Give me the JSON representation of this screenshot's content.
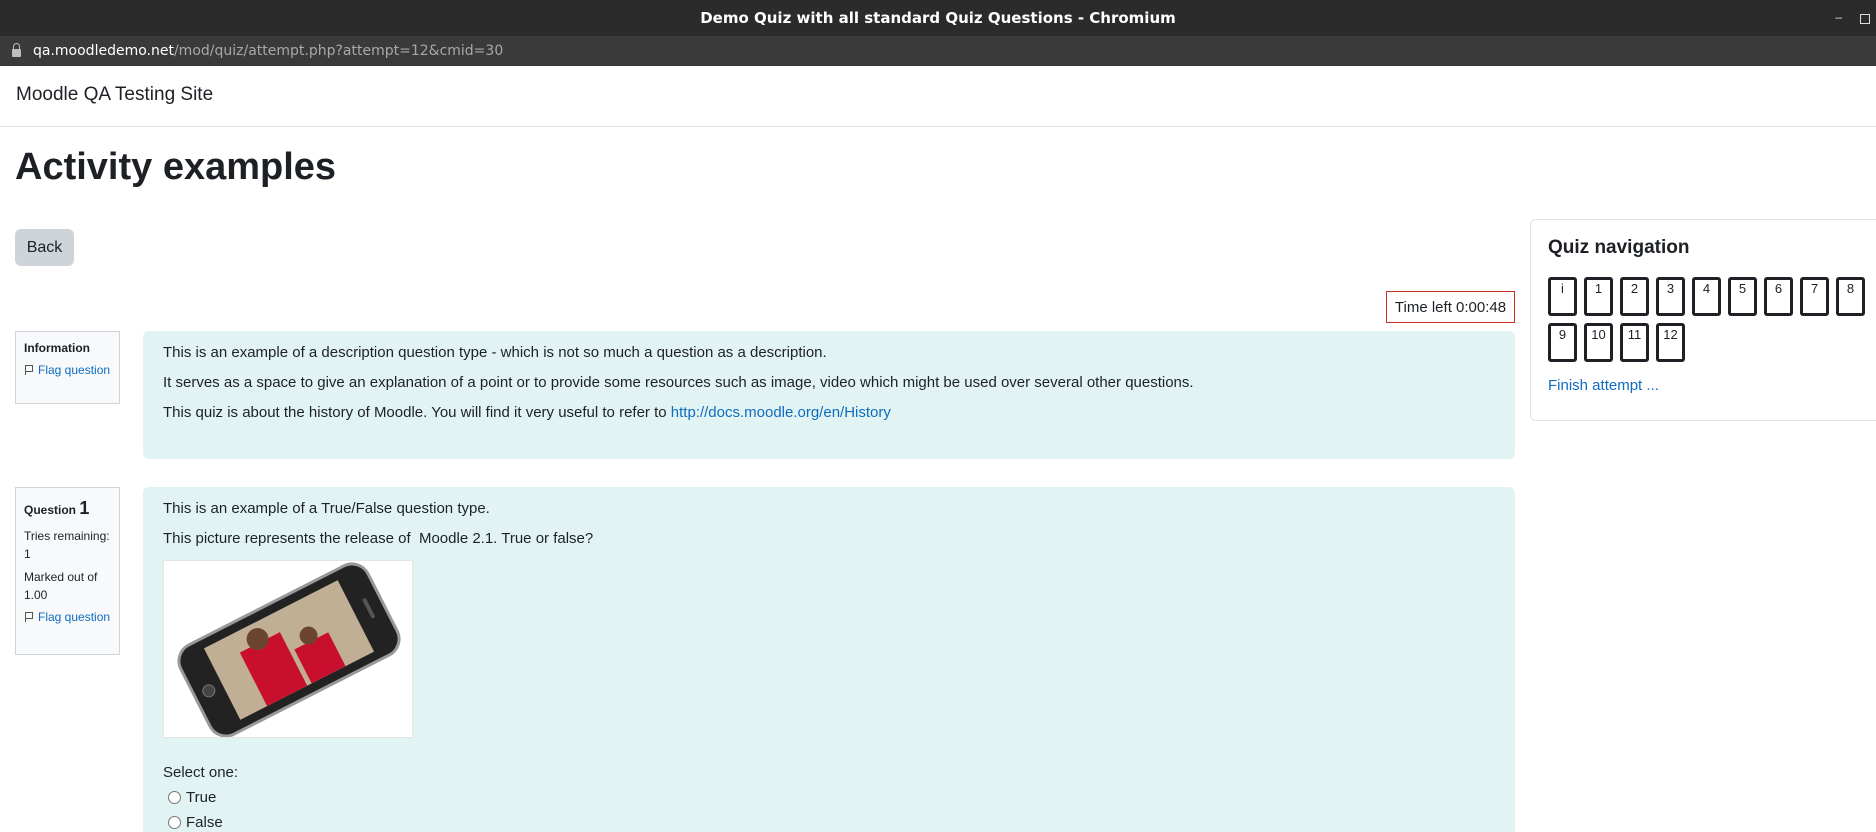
{
  "window": {
    "title": "Demo Quiz with all standard Quiz Questions - Chromium",
    "minimize_glyph": "–"
  },
  "address": {
    "host": "qa.moodledemo.net",
    "path": "/mod/quiz/attempt.php?attempt=12&cmid=30"
  },
  "site": {
    "name": "Moodle QA Testing Site"
  },
  "page": {
    "title": "Activity examples",
    "back_label": "Back"
  },
  "timer": {
    "text": "Time left 0:00:48"
  },
  "info_block": {
    "label": "Information",
    "flag_label": "Flag question",
    "paragraphs": [
      "This is an example of a description question type - which is not so much a question as a description.",
      "It serves as a space to give an explanation of a point or to provide some resources such as image, video which might be used over several other questions."
    ],
    "history_prefix": "This quiz is about the history of Moodle. You will find it very useful to refer to ",
    "history_link": "http://docs.moodle.org/en/History"
  },
  "question1": {
    "label": "Question",
    "number": "1",
    "tries": "Tries remaining: 1",
    "marked": "Marked out of 1.00",
    "flag_label": "Flag question",
    "intro": "This is an example of a True/False question type.",
    "prompt": "This picture represents the release of  Moodle 2.1. True or false?",
    "select_label": "Select one:",
    "options": [
      "True",
      "False"
    ]
  },
  "quiz_nav": {
    "title": "Quiz navigation",
    "buttons": [
      "i",
      "1",
      "2",
      "3",
      "4",
      "5",
      "6",
      "7",
      "8",
      "9",
      "10",
      "11",
      "12"
    ],
    "finish_label": "Finish attempt ..."
  }
}
